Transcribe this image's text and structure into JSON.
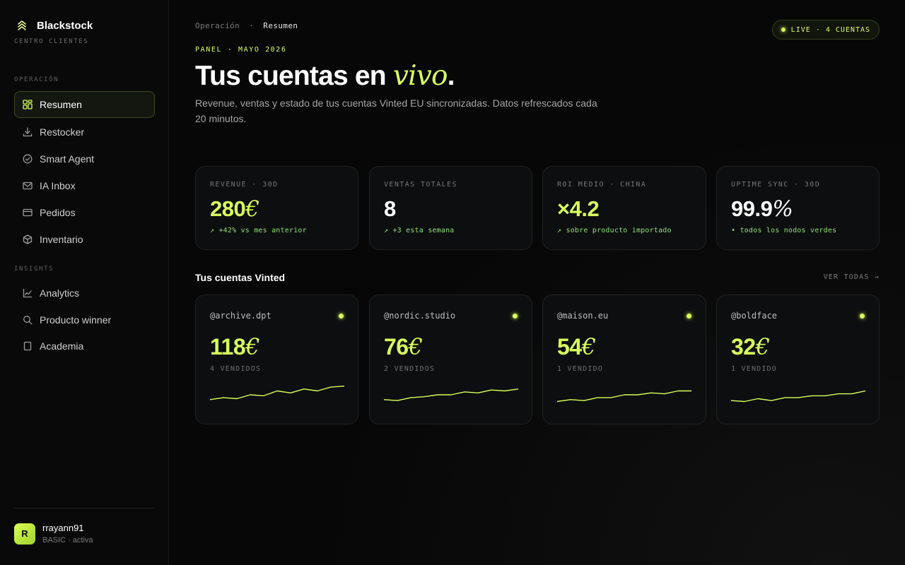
{
  "brand": {
    "name": "Blackstock",
    "subtitle": "CENTRO CLIENTES"
  },
  "sidebar": {
    "sections": [
      {
        "label": "OPERACIÓN"
      },
      {
        "label": "INSIGHTS"
      }
    ],
    "items": [
      {
        "label": "Resumen",
        "icon": "grid-icon",
        "active": true
      },
      {
        "label": "Restocker",
        "icon": "download-icon"
      },
      {
        "label": "Smart Agent",
        "icon": "check-circle-icon"
      },
      {
        "label": "IA Inbox",
        "icon": "mail-icon"
      },
      {
        "label": "Pedidos",
        "icon": "card-icon"
      },
      {
        "label": "Inventario",
        "icon": "box-icon"
      },
      {
        "label": "Analytics",
        "icon": "chart-icon"
      },
      {
        "label": "Producto winner",
        "icon": "search-icon"
      },
      {
        "label": "Academia",
        "icon": "book-icon"
      }
    ]
  },
  "user": {
    "initial": "R",
    "name": "rrayann91",
    "plan": "BASIC · activa"
  },
  "header": {
    "breadcrumb_parent": "Operación",
    "breadcrumb_sep": "·",
    "breadcrumb_current": "Resumen",
    "live_badge": "LIVE · 4 CUENTAS",
    "eyebrow": "PANEL · MAYO 2026",
    "title_main": "Tus cuentas en ",
    "title_accent": "vivo",
    "title_end": ".",
    "description": "Revenue, ventas y estado de tus cuentas Vinted EU sincronizadas. Datos refrescados cada 20 minutos."
  },
  "stats": [
    {
      "label": "REVENUE · 30D",
      "value": "280",
      "unit": "€",
      "note": "↗ +42% vs mes anterior",
      "value_color": "#d8ff5c"
    },
    {
      "label": "VENTAS TOTALES",
      "value": "8",
      "unit": "",
      "note": "↗ +3 esta semana",
      "value_color": "#ffffff"
    },
    {
      "label": "ROI MEDIO · CHINA",
      "value": "×4.2",
      "unit": "",
      "note": "↗ sobre producto importado",
      "value_color": "#d8ff5c"
    },
    {
      "label": "UPTIME SYNC · 30D",
      "value": "99.9",
      "unit": "%",
      "note": "• todos los nodos verdes",
      "value_color": "#ffffff"
    }
  ],
  "accounts_section": {
    "title": "Tus cuentas Vinted",
    "see_all": "VER TODAS →"
  },
  "accounts": [
    {
      "handle": "@archive.dpt",
      "value": "118",
      "unit": "€",
      "sold": "4 VENDIDOS",
      "spark": [
        6,
        8,
        7,
        11,
        10,
        15,
        13,
        17,
        15,
        19,
        20
      ]
    },
    {
      "handle": "@nordic.studio",
      "value": "76",
      "unit": "€",
      "sold": "2 VENDIDOS",
      "spark": [
        6,
        5,
        8,
        9,
        11,
        11,
        14,
        13,
        16,
        15,
        17
      ]
    },
    {
      "handle": "@maison.eu",
      "value": "54",
      "unit": "€",
      "sold": "1 VENDIDO",
      "spark": [
        4,
        6,
        5,
        8,
        8,
        11,
        11,
        13,
        12,
        15,
        15
      ]
    },
    {
      "handle": "@boldface",
      "value": "32",
      "unit": "€",
      "sold": "1 VENDIDO",
      "spark": [
        5,
        4,
        7,
        5,
        8,
        8,
        10,
        10,
        12,
        12,
        15
      ]
    }
  ],
  "colors": {
    "accent": "#d8ff5c",
    "positive": "#8fe07a",
    "background": "#060606"
  }
}
